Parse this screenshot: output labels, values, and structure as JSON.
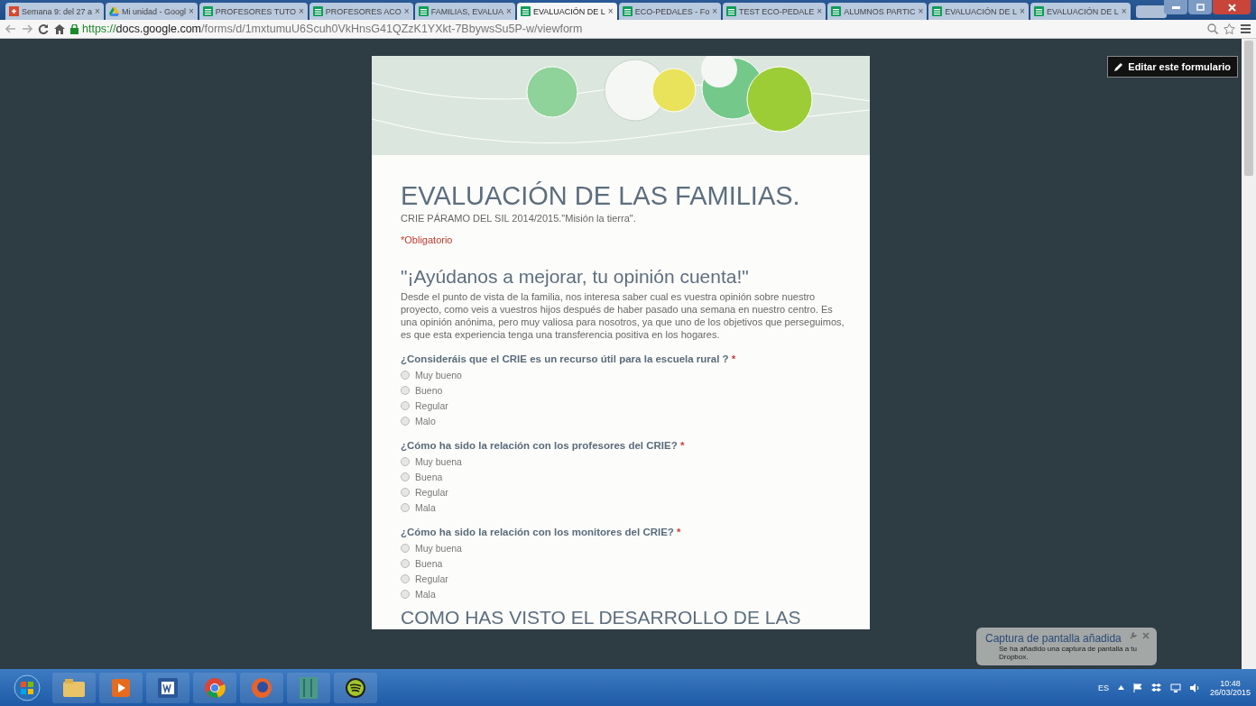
{
  "tabs": [
    {
      "kind": "social",
      "title": "Semana 9: del 27 a",
      "selected": false
    },
    {
      "kind": "drive",
      "title": "Mi unidad - Googl",
      "selected": false
    },
    {
      "kind": "sheet",
      "title": "PROFESORES TUTO",
      "selected": false
    },
    {
      "kind": "sheet",
      "title": "PROFESORES ACO",
      "selected": false
    },
    {
      "kind": "sheet",
      "title": "FAMILIAS, EVALUA",
      "selected": false
    },
    {
      "kind": "sheet",
      "title": "EVALUACIÓN DE L",
      "selected": true
    },
    {
      "kind": "sheet",
      "title": "ECO-PEDALES - Fo",
      "selected": false
    },
    {
      "kind": "sheet",
      "title": "TEST ECO-PEDALE",
      "selected": false
    },
    {
      "kind": "sheet",
      "title": "ALUMNOS PARTIC",
      "selected": false
    },
    {
      "kind": "sheet",
      "title": "EVALUACIÓN DE L",
      "selected": false
    },
    {
      "kind": "sheet",
      "title": "EVALUACIÓN DE L",
      "selected": false
    }
  ],
  "tab_close": "×",
  "address": {
    "scheme": "https://",
    "host": "docs.google.com",
    "path": "/forms/d/1mxtumuU6Scuh0VkHnsG41QZzK1YXkt-7BbywsSu5P-w/viewform"
  },
  "edit_button": "Editar este formulario",
  "form": {
    "title": "EVALUACIÓN DE LAS FAMILIAS.",
    "subtitle": "CRIE PÁRAMO DEL SIL 2014/2015.\"Misión la tierra\".",
    "required_note": "*Obligatorio",
    "section_title": "\"¡Ayúdanos a mejorar, tu opinión cuenta!\"",
    "section_text": "Desde el punto de vista de la familia, nos interesa saber cual es vuestra opinión sobre nuestro proyecto, como veis a vuestros hijos después de haber pasado una semana en nuestro centro. Es una opinión anónima, pero muy valiosa para nosotros, ya que uno de los objetivos que perseguimos, es que esta experiencia tenga una transferencia positiva en los hogares.",
    "questions": [
      {
        "text": "¿Consideráis que el CRIE es un recurso útil para la escuela rural ?",
        "required_mark": "*",
        "options": [
          {
            "label": "Muy bueno",
            "selected": false
          },
          {
            "label": "Bueno",
            "selected": false
          },
          {
            "label": "Regular",
            "selected": false
          },
          {
            "label": "Malo",
            "selected": false
          }
        ]
      },
      {
        "text": "¿Cómo ha sido la relación con los profesores del CRIE?",
        "required_mark": "*",
        "options": [
          {
            "label": "Muy buena",
            "selected": false
          },
          {
            "label": "Buena",
            "selected": false
          },
          {
            "label": "Regular",
            "selected": false
          },
          {
            "label": "Mala",
            "selected": false
          }
        ]
      },
      {
        "text": "¿Cómo ha sido la relación con los monitores del CRIE?",
        "required_mark": "*",
        "options": [
          {
            "label": "Muy buena",
            "selected": false
          },
          {
            "label": "Buena",
            "selected": false
          },
          {
            "label": "Regular",
            "selected": false
          },
          {
            "label": "Mala",
            "selected": false
          }
        ]
      }
    ],
    "next_section_title": "COMO HAS VISTO EL DESARROLLO DE LAS"
  },
  "notification": {
    "title": "Captura de pantalla añadida",
    "message": "Se ha añadido una captura de pantalla a tu Dropbox."
  },
  "taskbar": {
    "language": "ES",
    "time": "10:48",
    "date": "26/03/2015"
  }
}
